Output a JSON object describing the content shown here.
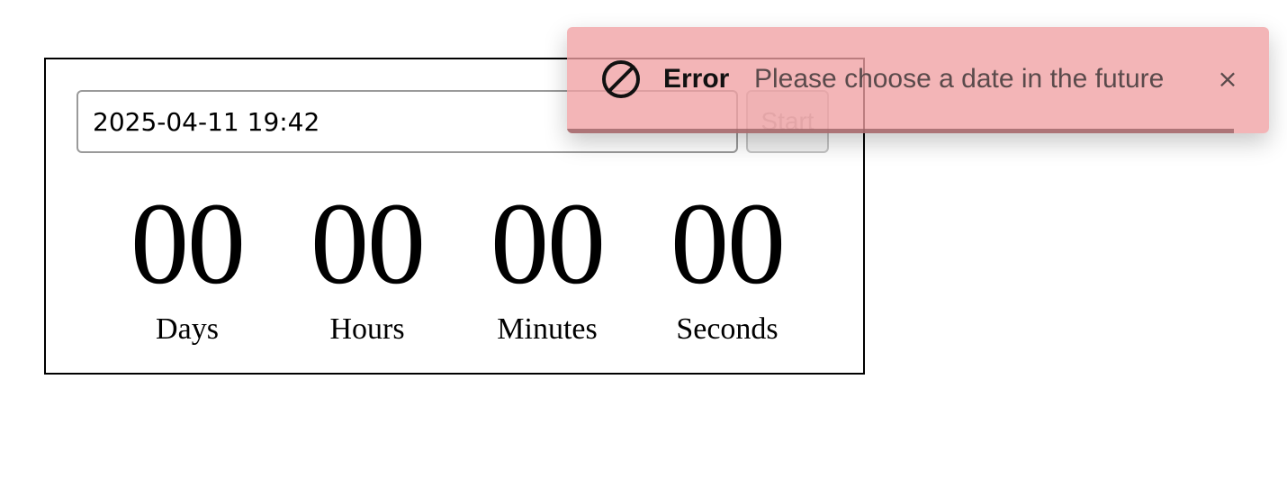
{
  "timer": {
    "date_value": "2025-04-11 19:42",
    "start_label": "Start",
    "units": [
      {
        "value": "00",
        "label": "Days"
      },
      {
        "value": "00",
        "label": "Hours"
      },
      {
        "value": "00",
        "label": "Minutes"
      },
      {
        "value": "00",
        "label": "Seconds"
      }
    ]
  },
  "toast": {
    "icon": "ban-icon",
    "title": "Error",
    "message": "Please choose a date in the future",
    "close_glyph": "×",
    "progress_fraction": 0.95,
    "colors": {
      "background": "#f0a0a3",
      "progress": "#965f62"
    }
  }
}
